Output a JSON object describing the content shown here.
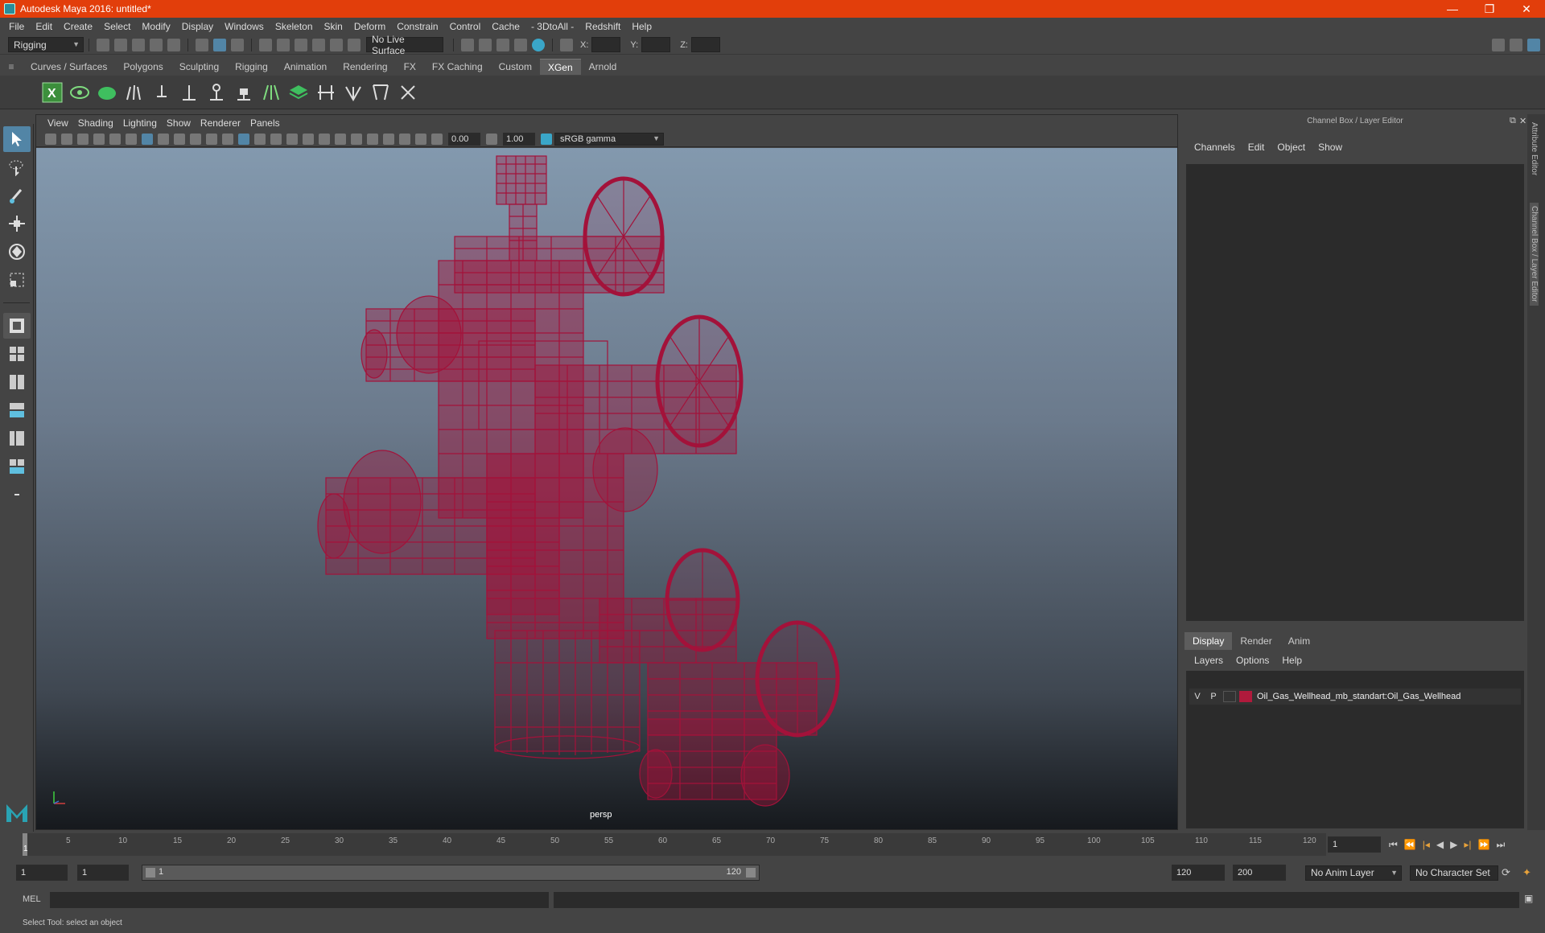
{
  "window": {
    "title": "Autodesk Maya 2016: untitled*"
  },
  "menubar": [
    "File",
    "Edit",
    "Create",
    "Select",
    "Modify",
    "Display",
    "Windows",
    "Skeleton",
    "Skin",
    "Deform",
    "Constrain",
    "Control",
    "Cache",
    "- 3DtoAll -",
    "Redshift",
    "Help"
  ],
  "statusline": {
    "mode": "Rigging",
    "live_surface": "No Live Surface",
    "x_label": "X:",
    "y_label": "Y:",
    "z_label": "Z:"
  },
  "shelf_tabs": [
    "Curves / Surfaces",
    "Polygons",
    "Sculpting",
    "Rigging",
    "Animation",
    "Rendering",
    "FX",
    "FX Caching",
    "Custom",
    "XGen",
    "Arnold"
  ],
  "active_shelf_tab": "XGen",
  "viewport": {
    "menu": [
      "View",
      "Shading",
      "Lighting",
      "Show",
      "Renderer",
      "Panels"
    ],
    "exposure": "0.00",
    "gamma": "1.00",
    "color_space": "sRGB gamma",
    "camera": "persp"
  },
  "right_panel": {
    "title": "Channel Box / Layer Editor",
    "cb_menu": [
      "Channels",
      "Edit",
      "Object",
      "Show"
    ],
    "layer_tabs": [
      "Display",
      "Render",
      "Anim"
    ],
    "active_layer_tab": "Display",
    "layer_menu": [
      "Layers",
      "Options",
      "Help"
    ],
    "layer": {
      "v": "V",
      "p": "P",
      "name": "Oil_Gas_Wellhead_mb_standart:Oil_Gas_Wellhead",
      "color": "#b01a3c"
    },
    "side_tabs": [
      "Attribute Editor",
      "Channel Box / Layer Editor"
    ]
  },
  "timeline": {
    "ticks": [
      "1",
      "5",
      "10",
      "15",
      "20",
      "25",
      "30",
      "35",
      "40",
      "45",
      "50",
      "55",
      "60",
      "65",
      "70",
      "75",
      "80",
      "85",
      "90",
      "95",
      "100",
      "105",
      "110",
      "115",
      "120"
    ],
    "current_frame": "1"
  },
  "range": {
    "start": "1",
    "playback_start": "1",
    "slider_start": "1",
    "slider_end": "120",
    "playback_end": "120",
    "end": "200",
    "anim_layer": "No Anim Layer",
    "char_set": "No Character Set"
  },
  "cmd": {
    "label": "MEL"
  },
  "help_line": "Select Tool: select an object",
  "colors": {
    "accent": "#e23e0b",
    "wire": "#a3123a",
    "active_tool": "#5285a6"
  }
}
